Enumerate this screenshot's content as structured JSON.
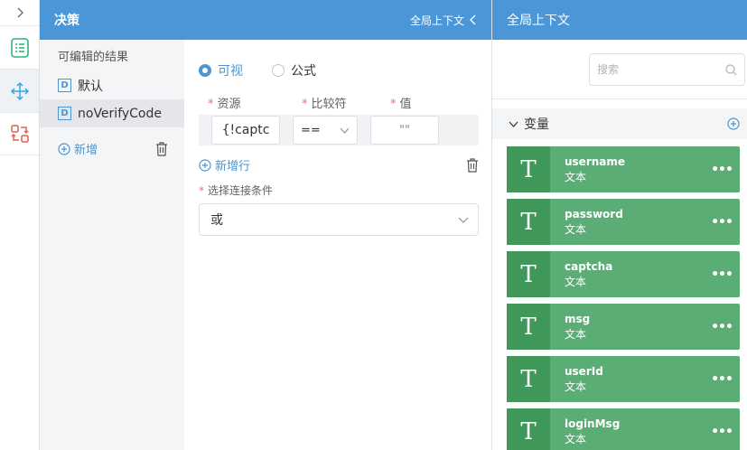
{
  "decision_panel": {
    "title": "决策",
    "context_link": "全局上下文"
  },
  "results": {
    "title": "可编辑的结果",
    "items": [
      {
        "badge": "D",
        "label": "默认"
      },
      {
        "badge": "D",
        "label": "noVerifyCode"
      }
    ],
    "add_label": "新增"
  },
  "editor": {
    "mode_options": [
      "可视",
      "公式"
    ],
    "columns": [
      "资源",
      "比较符",
      "值"
    ],
    "row": {
      "resource": "{!captc",
      "operator": "==",
      "value": "\"\""
    },
    "add_row_label": "新增行",
    "connector_label": "选择连接条件",
    "connector_value": "或"
  },
  "context_panel": {
    "title": "全局上下文",
    "search_placeholder": "搜索",
    "section_title": "变量",
    "variables": [
      {
        "name": "username",
        "type": "文本"
      },
      {
        "name": "password",
        "type": "文本"
      },
      {
        "name": "captcha",
        "type": "文本"
      },
      {
        "name": "msg",
        "type": "文本"
      },
      {
        "name": "userId",
        "type": "文本"
      },
      {
        "name": "loginMsg",
        "type": "文本"
      }
    ],
    "type_glyph": "T",
    "more_glyph": "•••"
  },
  "colors": {
    "header_blue": "#4a96d6",
    "var_green": "#5aae75",
    "var_green_dark": "#3f9759",
    "rail_icon_blue": "#3aa5e6",
    "rail_icon_red": "#e0604a",
    "rail_icon_green": "#2fb57a"
  }
}
